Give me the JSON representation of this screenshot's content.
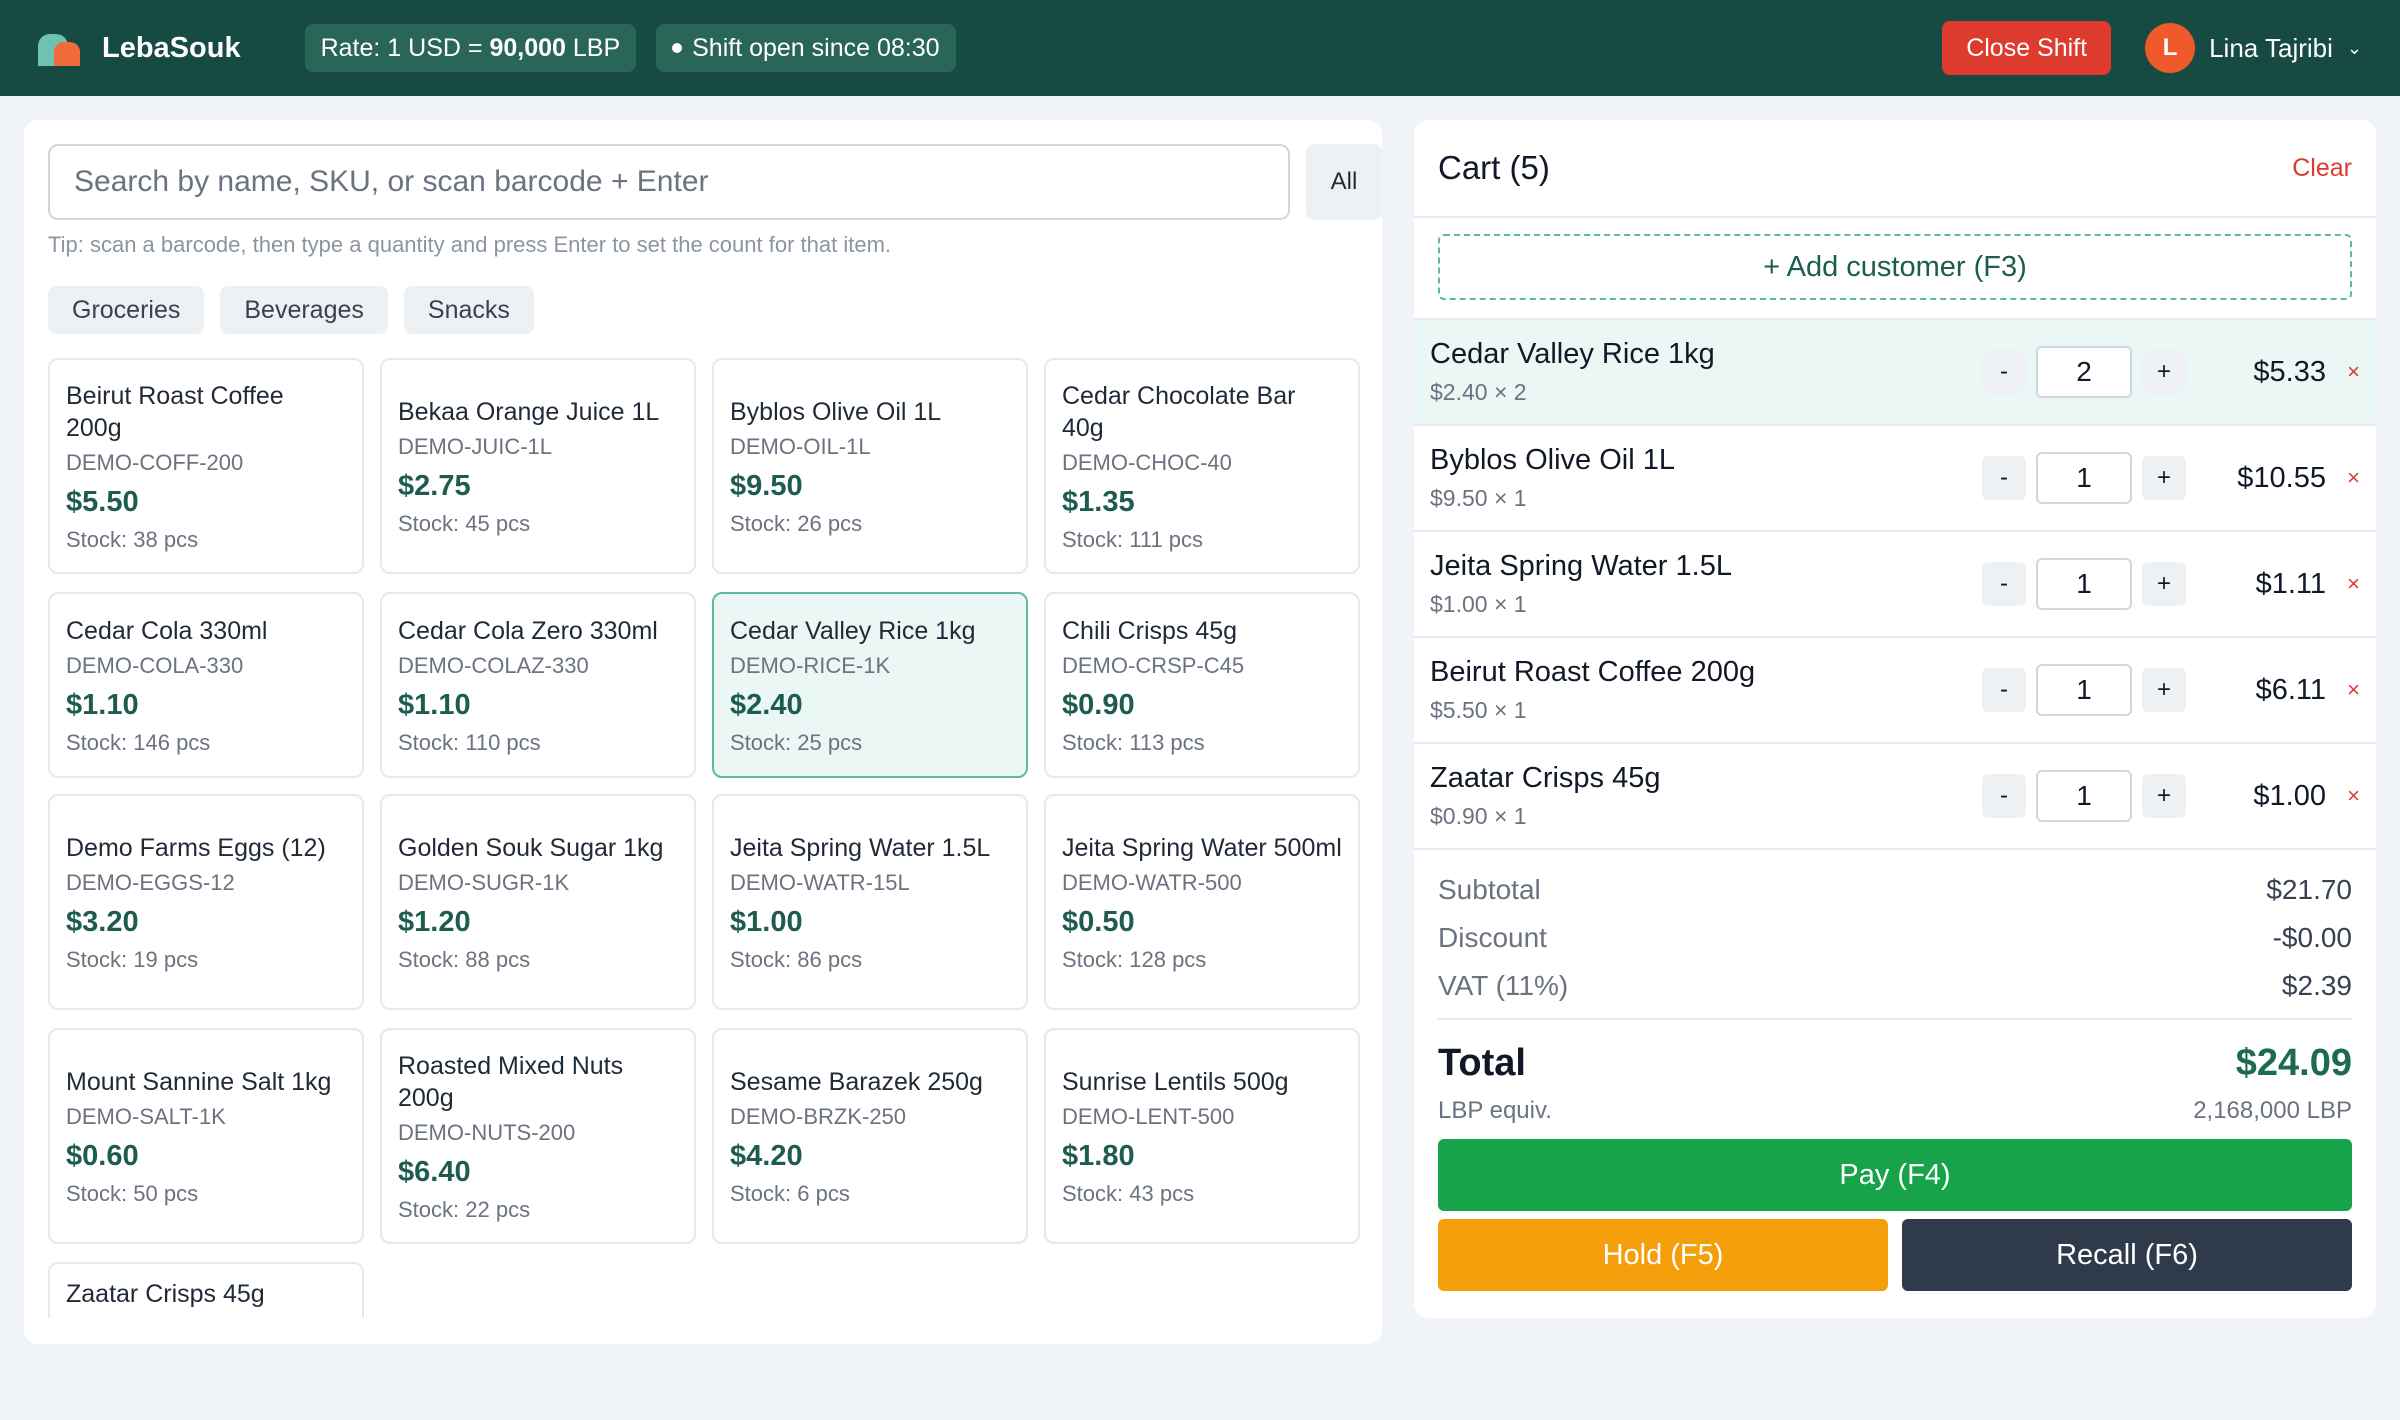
{
  "header": {
    "brand": "LebaSouk",
    "rate_prefix": "Rate: 1 USD = ",
    "rate_value": "90,000",
    "rate_suffix": " LBP",
    "shift_status": "Shift open since 08:30",
    "close_shift_label": "Close Shift",
    "user_initial": "L",
    "user_name": "Lina Tajribi",
    "colors": {
      "bar": "#174a42",
      "close_shift": "#dc3b2e",
      "avatar": "#f05a2a"
    }
  },
  "search": {
    "placeholder": "Search by name, SKU, or scan barcode + Enter",
    "all_label": "All",
    "tip": "Tip: scan a barcode, then type a quantity and press Enter to set the count for that item."
  },
  "categories": [
    "Groceries",
    "Beverages",
    "Snacks"
  ],
  "products": [
    {
      "name": "Beirut Roast Coffee 200g",
      "sku": "DEMO-COFF-200",
      "price": "$5.50",
      "stock": "Stock: 38 pcs"
    },
    {
      "name": "Bekaa Orange Juice 1L",
      "sku": "DEMO-JUIC-1L",
      "price": "$2.75",
      "stock": "Stock: 45 pcs"
    },
    {
      "name": "Byblos Olive Oil 1L",
      "sku": "DEMO-OIL-1L",
      "price": "$9.50",
      "stock": "Stock: 26 pcs"
    },
    {
      "name": "Cedar Chocolate Bar 40g",
      "sku": "DEMO-CHOC-40",
      "price": "$1.35",
      "stock": "Stock: 111 pcs"
    },
    {
      "name": "Cedar Cola 330ml",
      "sku": "DEMO-COLA-330",
      "price": "$1.10",
      "stock": "Stock: 146 pcs"
    },
    {
      "name": "Cedar Cola Zero 330ml",
      "sku": "DEMO-COLAZ-330",
      "price": "$1.10",
      "stock": "Stock: 110 pcs"
    },
    {
      "name": "Cedar Valley Rice 1kg",
      "sku": "DEMO-RICE-1K",
      "price": "$2.40",
      "stock": "Stock: 25 pcs",
      "selected": true
    },
    {
      "name": "Chili Crisps 45g",
      "sku": "DEMO-CRSP-C45",
      "price": "$0.90",
      "stock": "Stock: 113 pcs"
    },
    {
      "name": "Demo Farms Eggs (12)",
      "sku": "DEMO-EGGS-12",
      "price": "$3.20",
      "stock": "Stock: 19 pcs"
    },
    {
      "name": "Golden Souk Sugar 1kg",
      "sku": "DEMO-SUGR-1K",
      "price": "$1.20",
      "stock": "Stock: 88 pcs"
    },
    {
      "name": "Jeita Spring Water 1.5L",
      "sku": "DEMO-WATR-15L",
      "price": "$1.00",
      "stock": "Stock: 86 pcs"
    },
    {
      "name": "Jeita Spring Water 500ml",
      "sku": "DEMO-WATR-500",
      "price": "$0.50",
      "stock": "Stock: 128 pcs"
    },
    {
      "name": "Mount Sannine Salt 1kg",
      "sku": "DEMO-SALT-1K",
      "price": "$0.60",
      "stock": "Stock: 50 pcs"
    },
    {
      "name": "Roasted Mixed Nuts 200g",
      "sku": "DEMO-NUTS-200",
      "price": "$6.40",
      "stock": "Stock: 22 pcs"
    },
    {
      "name": "Sesame Barazek 250g",
      "sku": "DEMO-BRZK-250",
      "price": "$4.20",
      "stock": "Stock: 6 pcs"
    },
    {
      "name": "Sunrise Lentils 500g",
      "sku": "DEMO-LENT-500",
      "price": "$1.80",
      "stock": "Stock: 43 pcs"
    },
    {
      "name": "Zaatar Crisps 45g",
      "sku": "",
      "price": "",
      "stock": ""
    }
  ],
  "cart": {
    "title": "Cart (5)",
    "clear_label": "Clear",
    "add_customer_label": "+ Add customer (F3)",
    "lines": [
      {
        "name": "Cedar Valley Rice 1kg",
        "unit": "$2.40 × 2",
        "qty": "2",
        "total": "$5.33",
        "highlighted": true
      },
      {
        "name": "Byblos Olive Oil 1L",
        "unit": "$9.50 × 1",
        "qty": "1",
        "total": "$10.55"
      },
      {
        "name": "Jeita Spring Water 1.5L",
        "unit": "$1.00 × 1",
        "qty": "1",
        "total": "$1.11"
      },
      {
        "name": "Beirut Roast Coffee 200g",
        "unit": "$5.50 × 1",
        "qty": "1",
        "total": "$6.11"
      },
      {
        "name": "Zaatar Crisps 45g",
        "unit": "$0.90 × 1",
        "qty": "1",
        "total": "$1.00"
      }
    ],
    "minus_label": "-",
    "plus_label": "+",
    "remove_label": "×"
  },
  "totals": {
    "subtotal_label": "Subtotal",
    "subtotal": "$21.70",
    "discount_label": "Discount",
    "discount": "-$0.00",
    "vat_label": "VAT (11%)",
    "vat": "$2.39",
    "total_label": "Total",
    "total": "$24.09",
    "lbp_label": "LBP equiv.",
    "lbp": "2,168,000 LBP"
  },
  "actions": {
    "pay_label": "Pay (F4)",
    "hold_label": "Hold (F5)",
    "recall_label": "Recall (F6)",
    "colors": {
      "pay": "#16a34a",
      "hold": "#f59e0b",
      "recall": "#2f3b4b"
    }
  }
}
